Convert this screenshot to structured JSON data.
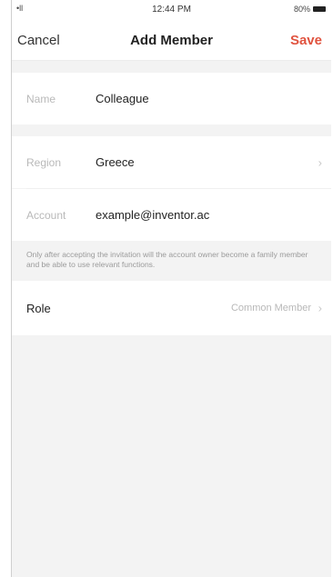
{
  "status_bar": {
    "signal": "•ll",
    "time": "12:44 PM",
    "battery_text": "80%"
  },
  "nav": {
    "cancel": "Cancel",
    "title": "Add Member",
    "save": "Save"
  },
  "form": {
    "name": {
      "label": "Name",
      "value": "Colleague"
    },
    "region": {
      "label": "Region",
      "value": "Greece"
    },
    "account": {
      "label": "Account",
      "value": "example@inventor.ac"
    }
  },
  "note": "Only after accepting the invitation will the account owner become a family member and be able to use relevant functions.",
  "role": {
    "label": "Role",
    "value": "Common Member"
  },
  "colors": {
    "accent": "#e0533f",
    "background": "#f3f3f3"
  },
  "icons": {
    "chevron": "chevron-right-icon",
    "battery": "battery-icon",
    "signal": "signal-icon"
  }
}
